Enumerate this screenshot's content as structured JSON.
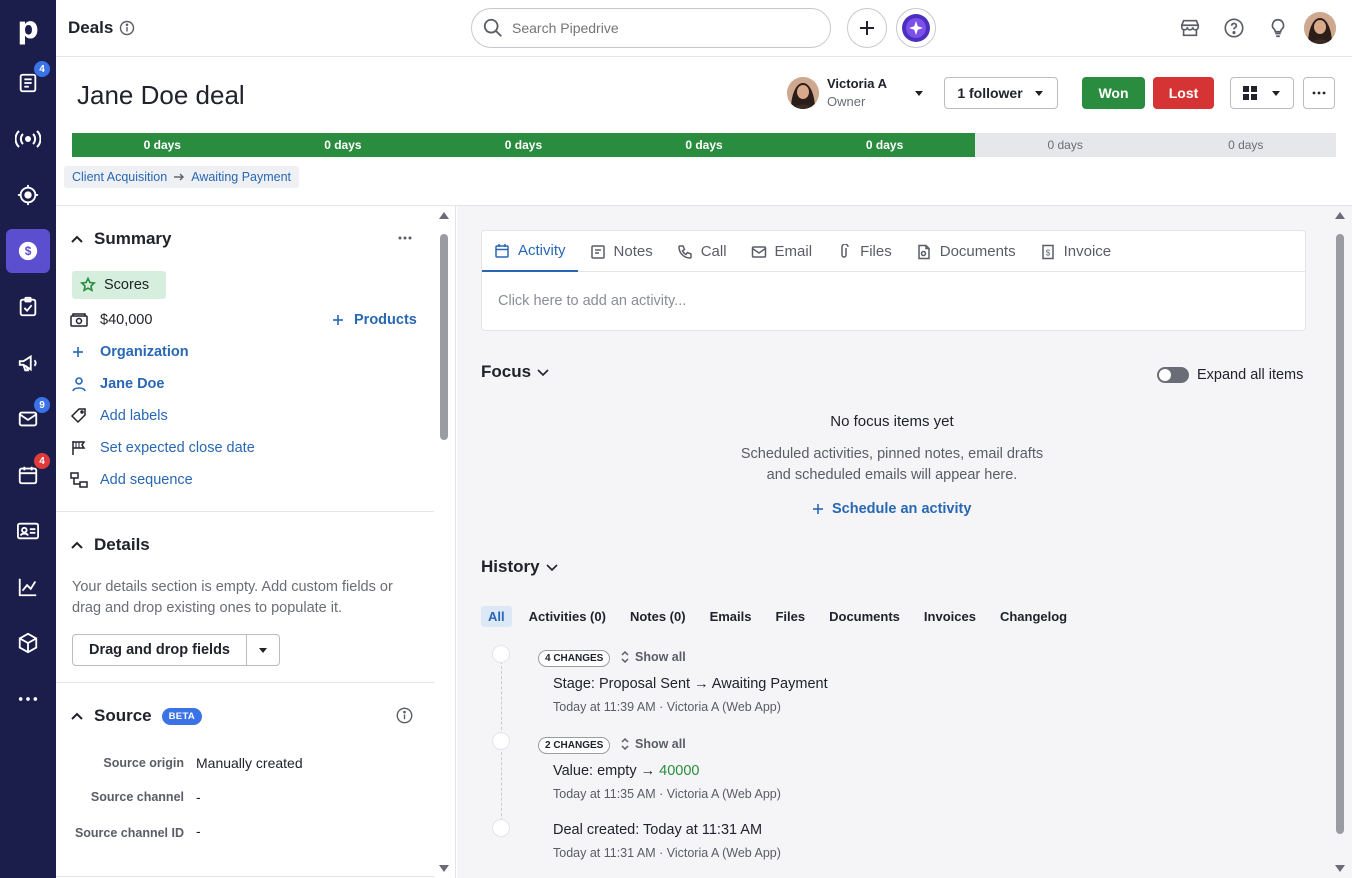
{
  "app": {
    "brand": "p",
    "page_title": "Deals",
    "accent": "#2867b4",
    "nav_bg": "#1b1e4b",
    "won_color": "#2a8c3e",
    "lost_color": "#d63434"
  },
  "nav": {
    "items": [
      {
        "name": "leads-icon",
        "badge": "4"
      },
      {
        "name": "broadcast-icon",
        "badge": ""
      },
      {
        "name": "target-icon",
        "badge": ""
      },
      {
        "name": "deals-icon",
        "badge": ""
      },
      {
        "name": "tasks-icon",
        "badge": ""
      },
      {
        "name": "campaigns-icon",
        "badge": ""
      },
      {
        "name": "mail-icon",
        "badge": "9"
      },
      {
        "name": "calendar-icon",
        "badge": "4"
      },
      {
        "name": "contacts-icon",
        "badge": ""
      },
      {
        "name": "insights-icon",
        "badge": ""
      },
      {
        "name": "products-icon",
        "badge": ""
      },
      {
        "name": "more-icon",
        "badge": ""
      }
    ]
  },
  "search": {
    "placeholder": "Search Pipedrive"
  },
  "deal": {
    "title": "Jane Doe deal",
    "owner_name": "Victoria A",
    "owner_role": "Owner",
    "followers": "1 follower",
    "won": "Won",
    "lost": "Lost"
  },
  "pipeline": {
    "stages": [
      {
        "label": "0 days",
        "done": true
      },
      {
        "label": "0 days",
        "done": true
      },
      {
        "label": "0 days",
        "done": true
      },
      {
        "label": "0 days",
        "done": true
      },
      {
        "label": "0 days",
        "done": true
      },
      {
        "label": "0 days",
        "done": false
      },
      {
        "label": "0 days",
        "done": false
      }
    ]
  },
  "breadcrumb": {
    "pipeline": "Client Acquisition",
    "stage": "Awaiting Payment"
  },
  "summary": {
    "title": "Summary",
    "scores": "Scores",
    "value": "$40,000",
    "products": "Products",
    "organization": "Organization",
    "person": "Jane Doe",
    "labels": "Add labels",
    "close_date": "Set expected close date",
    "sequence": "Add sequence"
  },
  "details": {
    "title": "Details",
    "empty_text": "Your details section is empty. Add custom fields or drag and drop existing ones to populate it.",
    "button": "Drag and drop fields"
  },
  "source": {
    "title": "Source",
    "badge": "BETA",
    "rows": [
      {
        "label": "Source origin",
        "value": "Manually created"
      },
      {
        "label": "Source channel",
        "value": "-"
      },
      {
        "label": "Source channel ID",
        "value": "-"
      }
    ]
  },
  "composer": {
    "tabs": [
      "Activity",
      "Notes",
      "Call",
      "Email",
      "Files",
      "Documents",
      "Invoice"
    ],
    "placeholder": "Click here to add an activity..."
  },
  "focus": {
    "title": "Focus",
    "expand_label": "Expand all items",
    "empty_title": "No focus items yet",
    "empty_line1": "Scheduled activities, pinned notes, email drafts",
    "empty_line2": "and scheduled emails will appear here.",
    "schedule": "Schedule an activity"
  },
  "history": {
    "title": "History",
    "tabs": [
      "All",
      "Activities (0)",
      "Notes (0)",
      "Emails",
      "Files",
      "Documents",
      "Invoices",
      "Changelog"
    ],
    "show_all": "Show all",
    "events": [
      {
        "changes": "4 CHANGES",
        "field": "Stage",
        "detail": "Proposal Sent → Awaiting Payment",
        "meta": "Today at 11:39 AM · Victoria A (Web App)"
      },
      {
        "changes": "2 CHANGES",
        "field": "Value",
        "detail_old": "empty →",
        "detail_new": "40000",
        "meta": "Today at 11:35 AM · Victoria A (Web App)"
      },
      {
        "field": "Deal created",
        "detail": "Today at 11:31 AM",
        "meta": "Today at 11:31 AM · Victoria A (Web App)"
      }
    ]
  }
}
